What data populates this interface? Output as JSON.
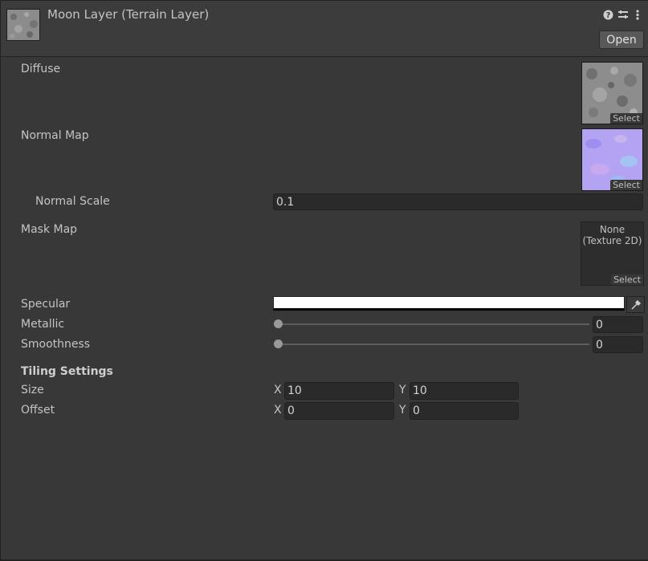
{
  "header": {
    "title": "Moon Layer (Terrain Layer)",
    "open_label": "Open",
    "icons": [
      "help-icon",
      "preset-icon",
      "more-menu-icon"
    ]
  },
  "properties": {
    "diffuse": {
      "label": "Diffuse",
      "select_label": "Select"
    },
    "normal_map": {
      "label": "Normal Map",
      "select_label": "Select"
    },
    "normal_scale": {
      "label": "Normal Scale",
      "value": "0.1"
    },
    "mask_map": {
      "label": "Mask Map",
      "none_line1": "None",
      "none_line2": "(Texture 2D)",
      "select_label": "Select"
    },
    "specular": {
      "label": "Specular",
      "color": "#ffffff"
    },
    "metallic": {
      "label": "Metallic",
      "value": "0"
    },
    "smoothness": {
      "label": "Smoothness",
      "value": "0"
    }
  },
  "tiling": {
    "heading": "Tiling Settings",
    "size": {
      "label": "Size",
      "x_label": "X",
      "x": "10",
      "y_label": "Y",
      "y": "10"
    },
    "offset": {
      "label": "Offset",
      "x_label": "X",
      "x": "0",
      "y_label": "Y",
      "y": "0"
    }
  },
  "colors": {
    "background": "#383838",
    "field": "#2a2a2a",
    "normal_tint": "#b7a6f2"
  }
}
